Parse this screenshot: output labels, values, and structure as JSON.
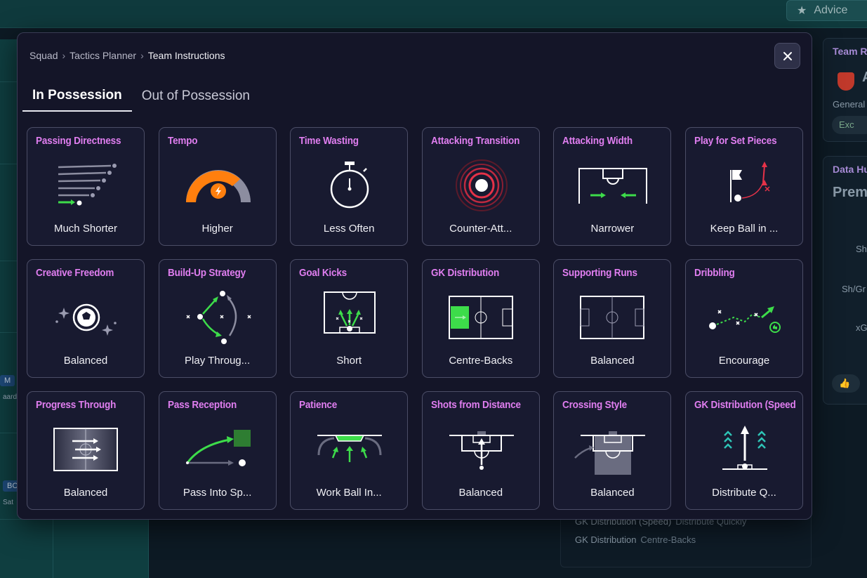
{
  "header": {
    "advice_label": "Advice",
    "advice_icon": "star-icon"
  },
  "background": {
    "left_chips": [
      "M",
      "BC"
    ],
    "left_texts": [
      "aard",
      "Sat"
    ],
    "summary_lines": [
      {
        "label": "GK Distribution (Speed)",
        "value": "Distribute Quickly"
      },
      {
        "label": "GK Distribution",
        "value": "Centre-Backs"
      }
    ],
    "panel_team": {
      "title": "Team Re",
      "big": "A",
      "text": "General",
      "pill": "Exc"
    },
    "panel_data": {
      "title": "Data Hu",
      "big": "Prem",
      "rows": [
        "Sh",
        "Sh/Gr",
        "xG"
      ]
    }
  },
  "modal": {
    "breadcrumb": [
      "Squad",
      "Tactics Planner",
      "Team Instructions"
    ],
    "close_icon": "close-icon",
    "tabs": [
      {
        "label": "In Possession",
        "active": true
      },
      {
        "label": "Out of Possession",
        "active": false
      }
    ],
    "cards": [
      {
        "title": "Passing Directness",
        "value": "Much Shorter",
        "icon": "passing-directness-icon"
      },
      {
        "title": "Tempo",
        "value": "Higher",
        "icon": "tempo-gauge-icon"
      },
      {
        "title": "Time Wasting",
        "value": "Less Often",
        "icon": "stopwatch-icon"
      },
      {
        "title": "Attacking Transition",
        "value": "Counter-Att...",
        "icon": "counter-attack-icon"
      },
      {
        "title": "Attacking Width",
        "value": "Narrower",
        "icon": "attacking-width-icon"
      },
      {
        "title": "Play for Set Pieces",
        "value": "Keep Ball in ...",
        "icon": "corner-flag-icon"
      },
      {
        "title": "Creative Freedom",
        "value": "Balanced",
        "icon": "creative-ball-icon"
      },
      {
        "title": "Build-Up Strategy",
        "value": "Play Throug...",
        "icon": "build-up-icon"
      },
      {
        "title": "Goal Kicks",
        "value": "Short",
        "icon": "goal-kick-icon"
      },
      {
        "title": "GK Distribution",
        "value": "Centre-Backs",
        "icon": "gk-distribution-pitch-icon"
      },
      {
        "title": "Supporting Runs",
        "value": "Balanced",
        "icon": "supporting-runs-pitch-icon"
      },
      {
        "title": "Dribbling",
        "value": "Encourage",
        "icon": "dribbling-icon"
      },
      {
        "title": "Progress Through",
        "value": "Balanced",
        "icon": "progress-through-icon"
      },
      {
        "title": "Pass Reception",
        "value": "Pass Into Sp...",
        "icon": "pass-reception-icon"
      },
      {
        "title": "Patience",
        "value": "Work Ball In...",
        "icon": "patience-icon"
      },
      {
        "title": "Shots from Distance",
        "value": "Balanced",
        "icon": "shots-distance-icon"
      },
      {
        "title": "Crossing Style",
        "value": "Balanced",
        "icon": "crossing-style-icon"
      },
      {
        "title": "GK Distribution (Speed",
        "value": "Distribute Q...",
        "icon": "gk-speed-icon"
      }
    ]
  }
}
